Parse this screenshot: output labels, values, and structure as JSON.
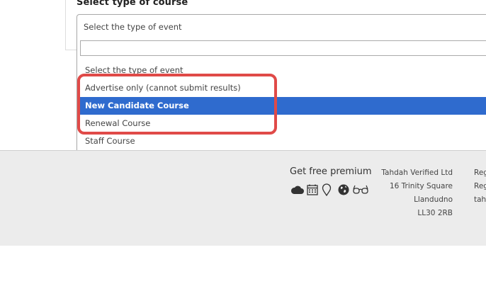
{
  "form": {
    "section_title": "Select type of course"
  },
  "select": {
    "current_value": "Select the type of event",
    "search_placeholder": "",
    "options": [
      "Select the type of event",
      "Advertise only (cannot submit results)",
      "New Candidate Course",
      "Renewal Course",
      "Staff Course"
    ],
    "highlighted_option": "New Candidate Course",
    "highlight_color": "#2f6bce"
  },
  "annotation": {
    "color": "#e04a48"
  },
  "footer": {
    "premium_label": "Get free premium",
    "premium_icons": [
      "cloud-icon",
      "calendar-icon",
      "map-pin-icon",
      "globe-icon",
      "glasses-icon"
    ],
    "company_lines": [
      "Tahdah Verified Ltd",
      "16 Trinity Square",
      "Llandudno",
      "LL30 2RB"
    ],
    "reg_lines": [
      "Reg",
      "Reg",
      "tah"
    ]
  }
}
